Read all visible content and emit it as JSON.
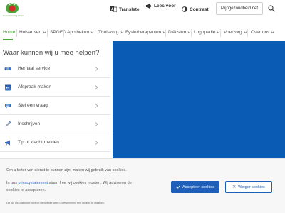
{
  "header": {
    "logo_text": "Huisartsenzorg Assen",
    "translate_label": "Translate",
    "read_aloud_label": "Lees voor",
    "contrast_label": "Contrast",
    "portal_label": "Mijngezondheid.net"
  },
  "nav": {
    "items": [
      {
        "label": "Home",
        "active": true,
        "has_dropdown": false
      },
      {
        "label": "Huisartsen",
        "active": false,
        "has_dropdown": true
      },
      {
        "label": "SPOED",
        "active": false,
        "has_dropdown": false
      },
      {
        "label": "Apotheken",
        "active": false,
        "has_dropdown": true
      },
      {
        "label": "Thuiszorg",
        "active": false,
        "has_dropdown": true
      },
      {
        "label": "Fysiotherapeuten",
        "active": false,
        "has_dropdown": true
      },
      {
        "label": "Diëtisten",
        "active": false,
        "has_dropdown": true
      },
      {
        "label": "Logopedie",
        "active": false,
        "has_dropdown": true
      },
      {
        "label": "Voetzorg",
        "active": false,
        "has_dropdown": true
      },
      {
        "label": "Over ons",
        "active": false,
        "has_dropdown": true
      }
    ]
  },
  "main": {
    "question": "Waar kunnen wij u mee helpen?",
    "services": [
      {
        "label": "Herhaal service",
        "icon": "pills-icon"
      },
      {
        "label": "Afspraak maken",
        "icon": "calendar-icon"
      },
      {
        "label": "Stel een vraag",
        "icon": "chat-icon"
      },
      {
        "label": "Inschrijven",
        "icon": "pen-icon"
      },
      {
        "label": "Tip of klacht melden",
        "icon": "megaphone-icon"
      }
    ]
  },
  "cookie": {
    "line1": "Om u beter van dienst te kunnen zijn, maken wij gebruik van cookies.",
    "line2_prefix": "In ons",
    "line2_link": "privacystatement",
    "line2_suffix": "staan free wij cookies moeten. Wij adviseren de",
    "line3": "cookies te accepteren.",
    "fine_print": "Let op: als u akkoord bent op de website geeft u toestemming tem cookies te plaatsen.",
    "accept_label": "Accepteer cookies",
    "deny_label": "Weiger cookies"
  },
  "colors": {
    "brand_green": "#4aa63a",
    "hero_blue": "#0a5bb4",
    "button_blue": "#1d5fb9"
  }
}
